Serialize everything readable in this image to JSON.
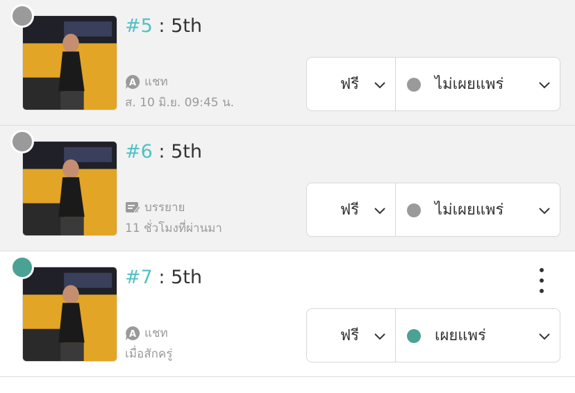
{
  "colors": {
    "accent": "#52c0c4",
    "unpublished": "#9a9a9a",
    "published": "#4ba294"
  },
  "episodes": [
    {
      "number": "#5",
      "separator": " : ",
      "name": "5th",
      "type_icon": "chat-a-icon",
      "type_label": "แชท",
      "time": "ส. 10 มิ.ย. 09:45 น.",
      "price": "ฟรี",
      "status": "ไม่เผยแพร่",
      "status_color": "#9a9a9a",
      "has_more": false
    },
    {
      "number": "#6",
      "separator": " : ",
      "name": "5th",
      "type_icon": "narration-icon",
      "type_label": "บรรยาย",
      "time": "11 ชั่วโมงที่ผ่านมา",
      "price": "ฟรี",
      "status": "ไม่เผยแพร่",
      "status_color": "#9a9a9a",
      "has_more": false
    },
    {
      "number": "#7",
      "separator": " : ",
      "name": "5th",
      "type_icon": "chat-a-icon",
      "type_label": "แชท",
      "time": "เมื่อสักครู่",
      "price": "ฟรี",
      "status": "เผยแพร่",
      "status_color": "#4ba294",
      "has_more": true
    }
  ]
}
